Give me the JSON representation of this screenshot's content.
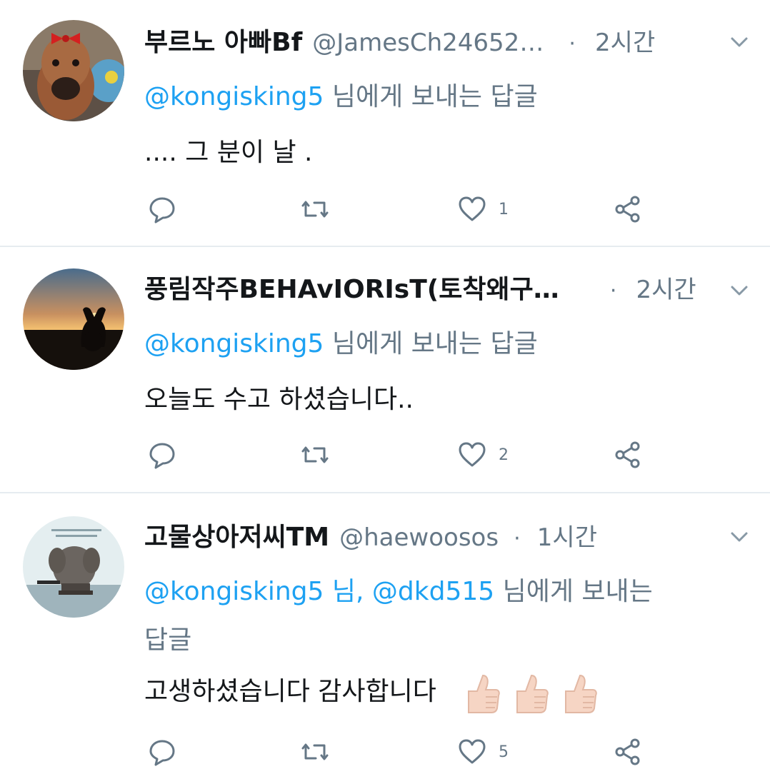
{
  "tweets": [
    {
      "name": "부르노 아빠Bf",
      "handle": "@JamesCh24652…",
      "separator": "·",
      "time": "2시간",
      "reply_mention1": "@kongisking5",
      "reply_mid": "",
      "reply_mention2": "",
      "reply_suffix": " 님에게 보내는 답글",
      "reply_suffix2": "",
      "text": ".... 그 분이 날 .",
      "likes": "1",
      "colors": {
        "avatar_bg": "#6b5a4a"
      }
    },
    {
      "name": "풍림작주BEHAvIORIsT(토착왜구…",
      "handle": "",
      "separator": "·",
      "time": "2시간",
      "reply_mention1": "@kongisking5",
      "reply_mid": "",
      "reply_mention2": "",
      "reply_suffix": " 님에게 보내는 답글",
      "reply_suffix2": "",
      "text": "오늘도 수고 하셨습니다..",
      "likes": "2",
      "colors": {
        "avatar_bg": "#3a2a22"
      }
    },
    {
      "name": "고물상아저씨TM",
      "handle": "@haewoosos",
      "separator": "·",
      "time": "1시간",
      "reply_mention1": "@kongisking5",
      "reply_mid": " 님, ",
      "reply_mention2": "@dkd515",
      "reply_suffix": " 님에게 보내는",
      "reply_suffix2": "답글",
      "text": "고생하셨습니다 감사합니다",
      "likes": "5",
      "emoji": "thumbs-up x3",
      "colors": {
        "avatar_bg": "#dfe9ec"
      }
    }
  ],
  "colors": {
    "accent": "#1da1f2",
    "muted": "#657786",
    "divider": "#e6ecf0",
    "text": "#14171a"
  },
  "icons": {
    "reply": "comment-icon",
    "retweet": "retweet-icon",
    "like": "heart-icon",
    "share": "share-icon",
    "menu": "chevron-down-icon"
  }
}
